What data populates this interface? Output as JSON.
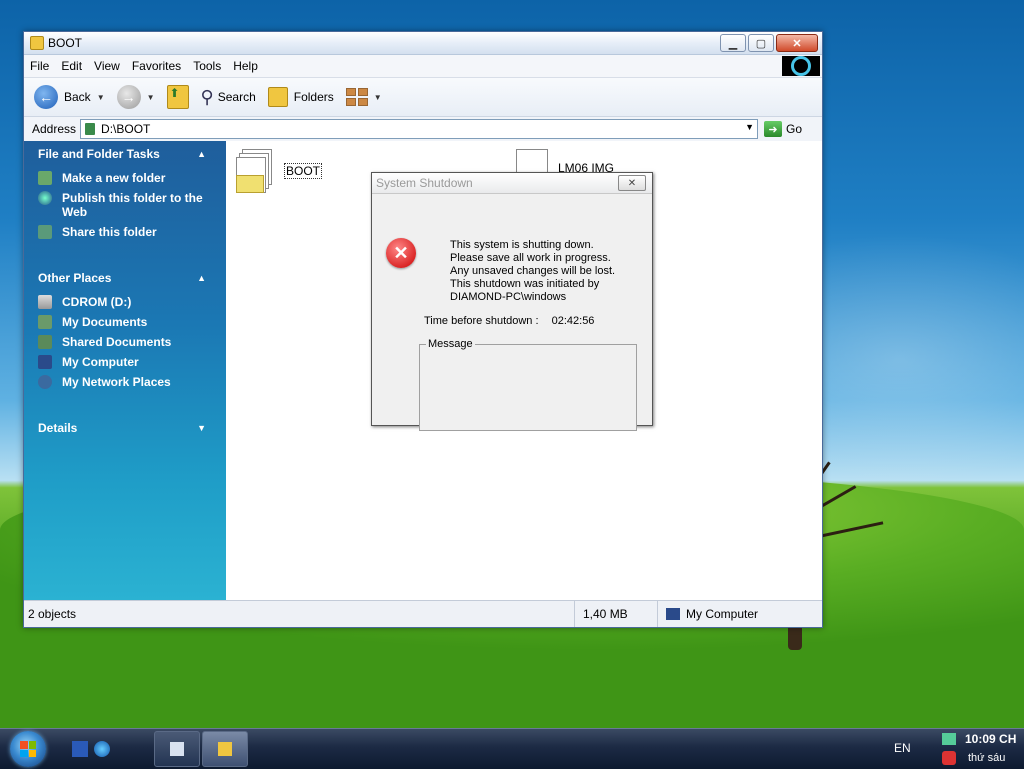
{
  "window": {
    "title": "BOOT",
    "menu": [
      "File",
      "Edit",
      "View",
      "Favorites",
      "Tools",
      "Help"
    ],
    "toolbar": {
      "back": "Back",
      "search": "Search",
      "folders": "Folders"
    },
    "address": {
      "label": "Address",
      "value": "D:\\BOOT",
      "go": "Go"
    },
    "taskpane": {
      "file_tasks": {
        "title": "File and Folder Tasks",
        "items": [
          "Make a new folder",
          "Publish this folder to the Web",
          "Share this folder"
        ]
      },
      "other_places": {
        "title": "Other Places",
        "items": [
          "CDROM (D:)",
          "My Documents",
          "Shared Documents",
          "My Computer",
          "My Network Places"
        ]
      },
      "details": {
        "title": "Details"
      }
    },
    "files": [
      {
        "name": "BOOT"
      },
      {
        "name": "LM06 IMG"
      }
    ],
    "status": {
      "objects": "2 objects",
      "size": "1,40 MB",
      "location": "My Computer"
    }
  },
  "dialog": {
    "title": "System Shutdown",
    "lines": [
      "This system is shutting down.",
      "Please save all work in progress.",
      "Any unsaved changes will be lost.",
      "This shutdown was initiated by",
      "DIAMOND-PC\\windows"
    ],
    "time_label": "Time before shutdown :",
    "time_value": "02:42:56",
    "message_label": "Message"
  },
  "taskbar": {
    "language": "EN",
    "clock": "10:09 CH",
    "day": "thứ sáu"
  },
  "colors": {
    "taskpane_top": "#1f5e9c",
    "taskpane_bottom": "#2bb2d2",
    "error_red": "#cc0000"
  }
}
